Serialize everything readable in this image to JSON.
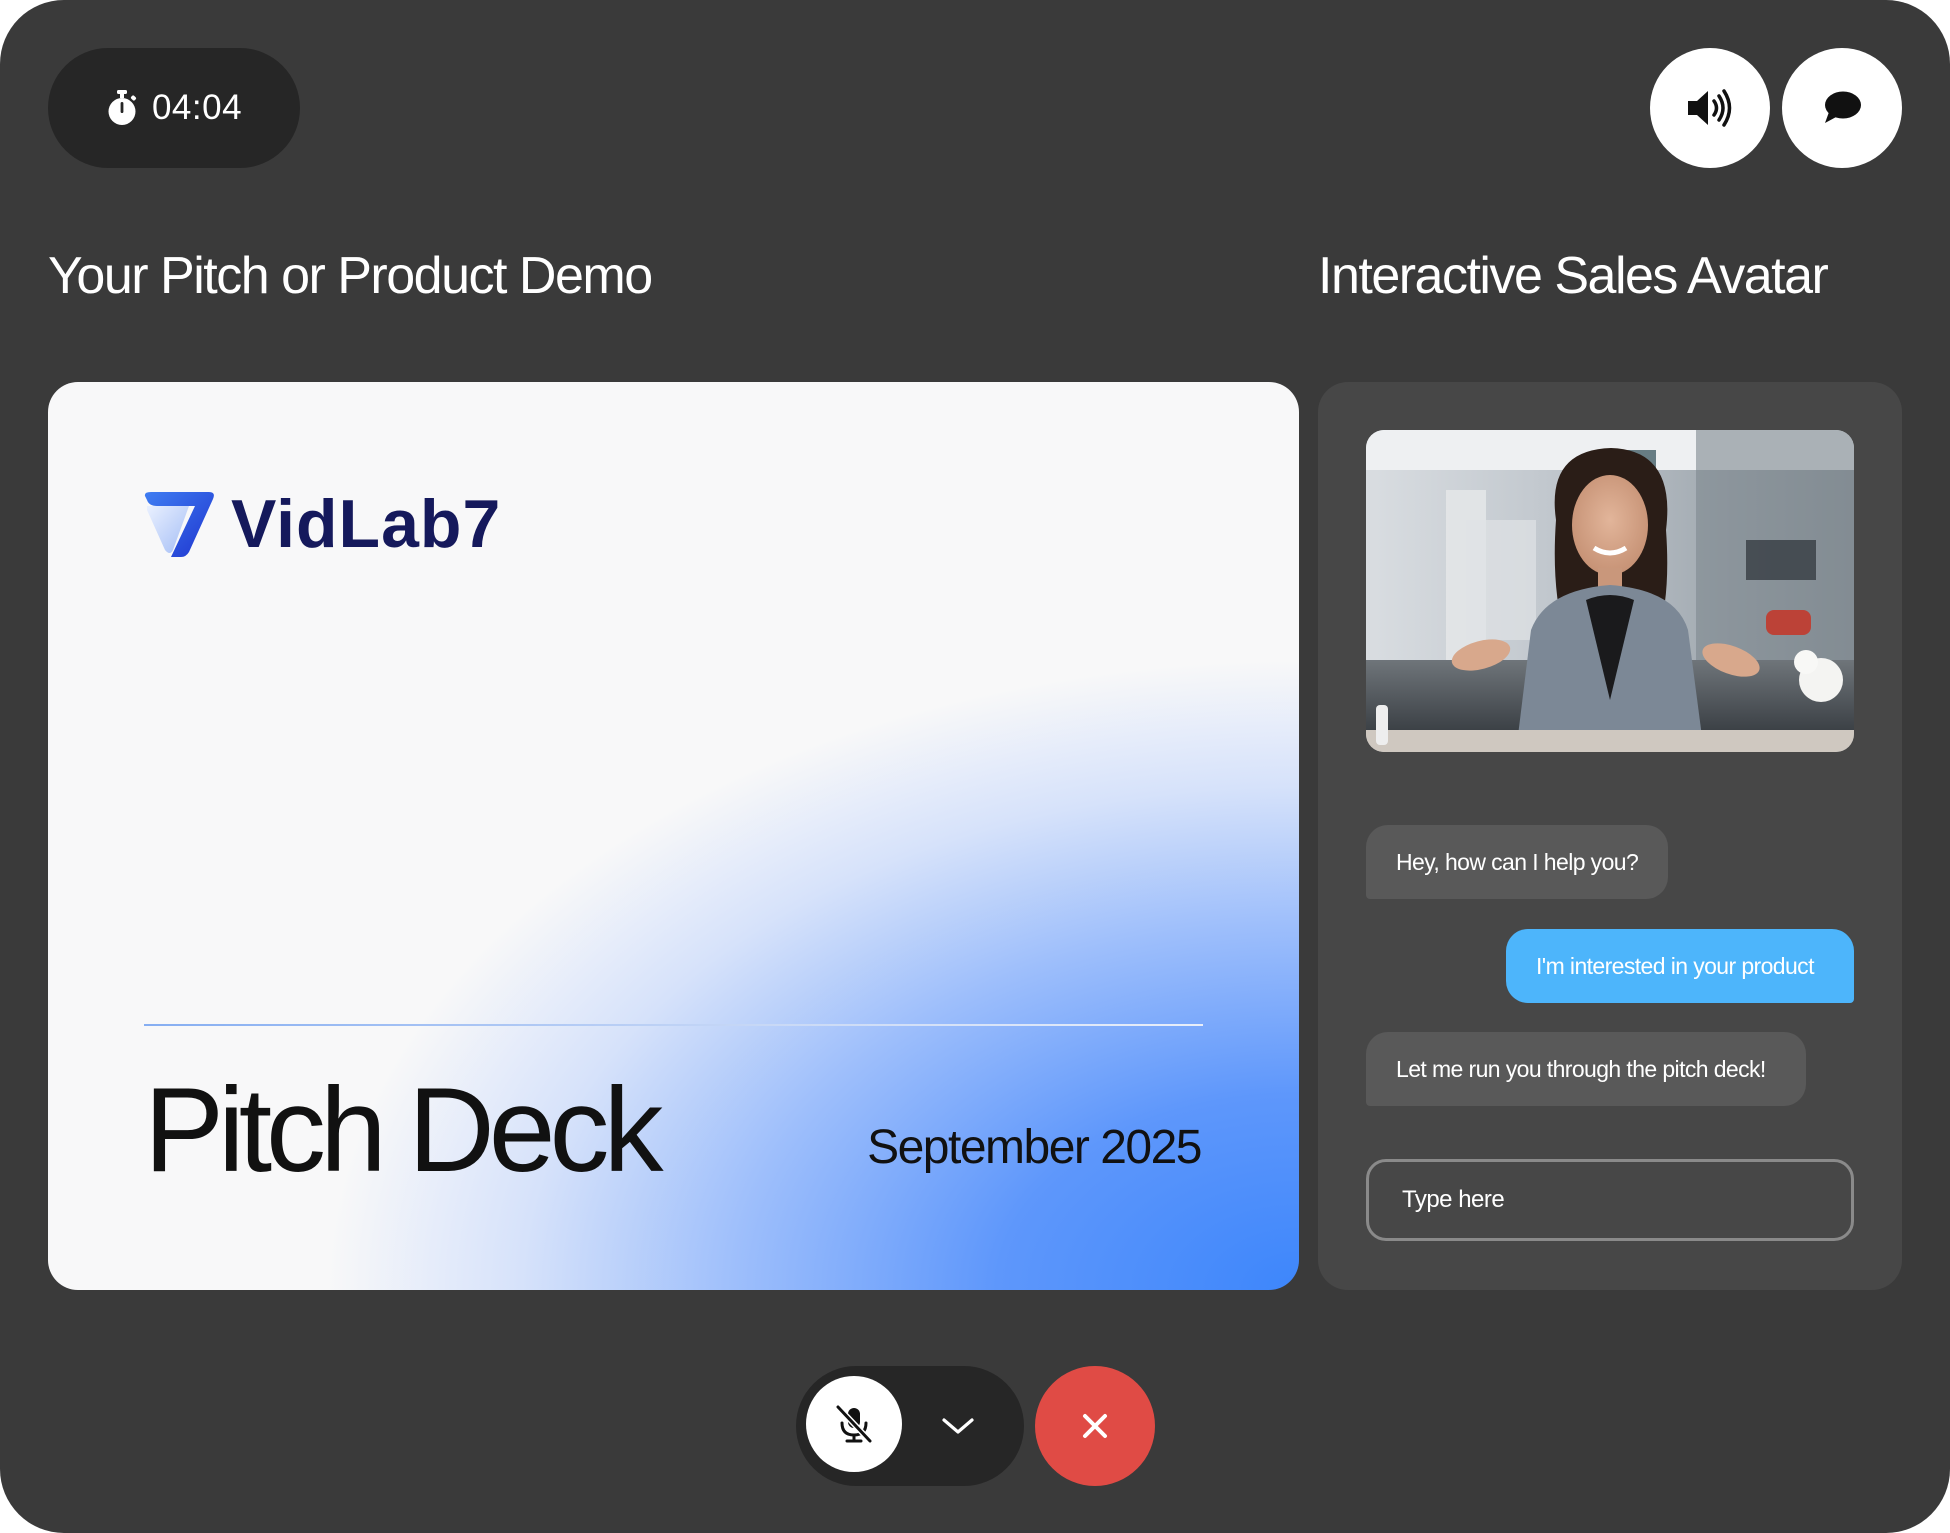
{
  "timer": {
    "value": "04:04",
    "icon": "stopwatch-icon"
  },
  "top_actions": {
    "volume_icon": "volume-icon",
    "chat_icon": "chat-bubble-icon"
  },
  "left_heading": "Your Pitch or Product Demo",
  "right_heading": "Interactive Sales Avatar",
  "slide": {
    "brand": "VidLab7",
    "title": "Pitch Deck",
    "date": "September 2025"
  },
  "chat": {
    "messages": [
      {
        "from": "avatar",
        "text": "Hey, how can I help you?"
      },
      {
        "from": "user",
        "text": "I'm interested in your product"
      },
      {
        "from": "avatar",
        "text": "Let me run you through the pitch deck!"
      }
    ],
    "input_placeholder": "Type here"
  },
  "controls": {
    "mic_icon": "mic-muted-icon",
    "chevron_icon": "chevron-down-icon",
    "end_icon": "close-icon"
  },
  "colors": {
    "frame": "#3a3a3a",
    "panel": "#474747",
    "user_bubble": "#4db5fb",
    "avatar_bubble": "#595959",
    "end_call": "#e04b45",
    "brand": "#15195c"
  }
}
